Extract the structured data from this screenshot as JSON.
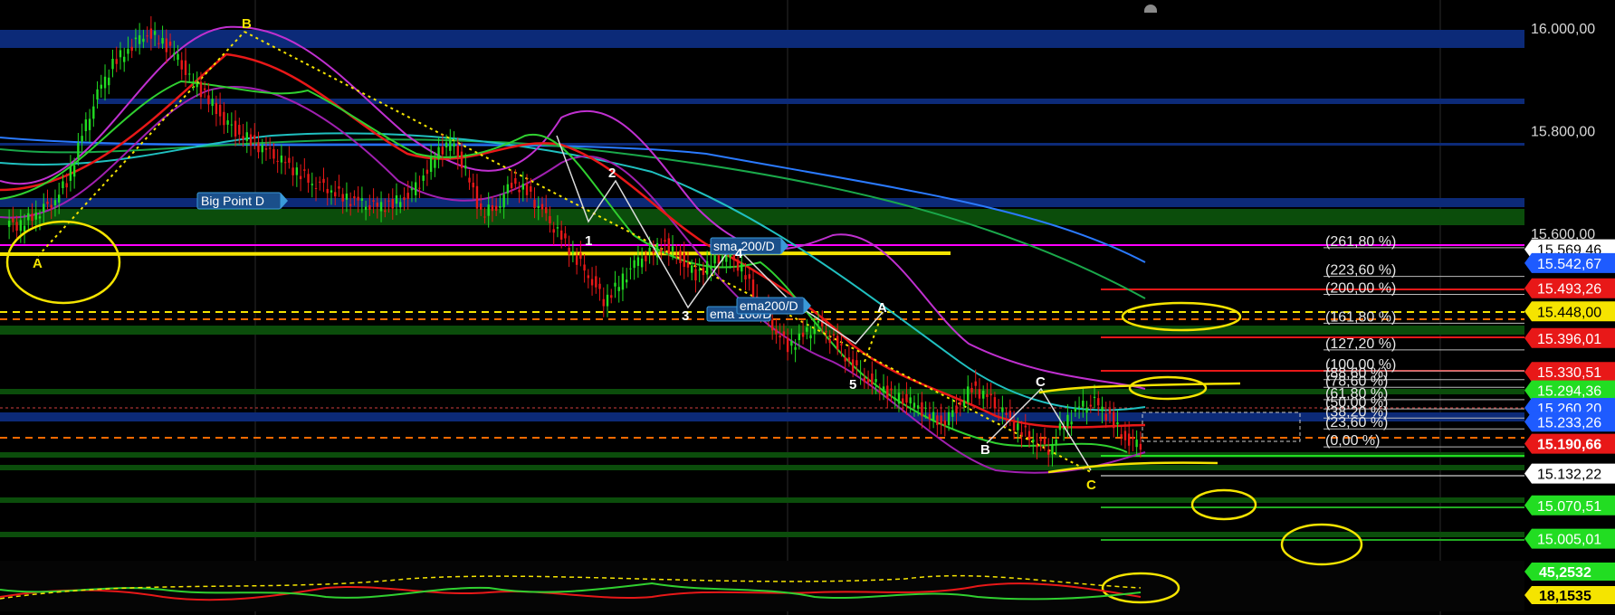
{
  "chart_data": {
    "type": "candlestick",
    "title": "",
    "ylim": [
      14950,
      16080
    ],
    "y_ticks": [
      "16.000,00",
      "15.800,00",
      "15.600,00"
    ],
    "y_tick_values": [
      16000,
      15800,
      15600
    ],
    "fib_levels": [
      {
        "label": "(261,80 %)",
        "value": 15572
      },
      {
        "label": "(223,60 %)",
        "value": 15516
      },
      {
        "label": "(200,00 %)",
        "value": 15481
      },
      {
        "label": "(161,80 %)",
        "value": 15425
      },
      {
        "label": "(127,20 %)",
        "value": 15373
      },
      {
        "label": "(100,00 %)",
        "value": 15332
      },
      {
        "label": "(88,60 %)",
        "value": 15315
      },
      {
        "label": "(78,60 %)",
        "value": 15300
      },
      {
        "label": "(61,80 %)",
        "value": 15276
      },
      {
        "label": "(50,00 %)",
        "value": 15258
      },
      {
        "label": "(38,20 %)",
        "value": 15240
      },
      {
        "label": "(23,60 %)",
        "value": 15219
      },
      {
        "label": "(0,00 %)",
        "value": 15184
      }
    ],
    "price_tags": [
      {
        "text": "15.569,46",
        "value": 15569,
        "color": "#ffffff",
        "text_color": "#000000"
      },
      {
        "text": "15.542,67",
        "value": 15542,
        "color": "#1e5bff",
        "text_color": "#ffffff"
      },
      {
        "text": "15.493,26",
        "value": 15493,
        "color": "#e81818",
        "text_color": "#ffffff"
      },
      {
        "text": "15.448,00",
        "value": 15448,
        "color": "#f5e400",
        "text_color": "#000000"
      },
      {
        "text": "15.396,01",
        "value": 15396,
        "color": "#e81818",
        "text_color": "#ffffff"
      },
      {
        "text": "15.330,51",
        "value": 15330,
        "color": "#e81818",
        "text_color": "#ffffff"
      },
      {
        "text": "15.294,36",
        "value": 15294,
        "color": "#22dd22",
        "text_color": "#ffffff"
      },
      {
        "text": "15.260,20",
        "value": 15260,
        "color": "#1e5bff",
        "text_color": "#ffffff"
      },
      {
        "text": "15.233,26",
        "value": 15233,
        "color": "#1e5bff",
        "text_color": "#ffffff"
      },
      {
        "text": "15.190,66",
        "value": 15190,
        "color": "#e81818",
        "text_color": "#ffffff",
        "bold": true
      },
      {
        "text": "15.132,22",
        "value": 15132,
        "color": "#ffffff",
        "text_color": "#000000"
      },
      {
        "text": "15.070,51",
        "value": 15070,
        "color": "#22dd22",
        "text_color": "#ffffff"
      },
      {
        "text": "15.005,01",
        "value": 15005,
        "color": "#22dd22",
        "text_color": "#ffffff"
      }
    ],
    "indicator_tags": [
      {
        "text": "45,2532",
        "color": "#22dd22",
        "text_color": "#ffffff"
      },
      {
        "text": "18,1535",
        "color": "#f5e400",
        "text_color": "#000000"
      }
    ],
    "annotations": {
      "big_point": "Big Point D",
      "sma200": "sma 200/D",
      "ema200": "ema200/D",
      "ema100": "ema 100/D"
    },
    "wave_labels": [
      {
        "text": "A",
        "color": "#f5e400"
      },
      {
        "text": "B",
        "color": "#f5e400"
      },
      {
        "text": "1",
        "color": "#ffffff"
      },
      {
        "text": "2",
        "color": "#ffffff"
      },
      {
        "text": "3",
        "color": "#ffffff"
      },
      {
        "text": "4",
        "color": "#ffffff"
      },
      {
        "text": "5",
        "color": "#ffffff"
      },
      {
        "text": "A",
        "color": "#ffffff"
      },
      {
        "text": "B",
        "color": "#ffffff"
      },
      {
        "text": "C",
        "color": "#ffffff"
      },
      {
        "text": "C",
        "color": "#f5e400"
      }
    ],
    "close_series": [
      15620,
      15615,
      15640,
      15660,
      15700,
      15790,
      15870,
      15930,
      15960,
      15990,
      15980,
      15950,
      15900,
      15870,
      15830,
      15800,
      15780,
      15760,
      15740,
      15720,
      15700,
      15690,
      15670,
      15660,
      15650,
      15655,
      15670,
      15700,
      15750,
      15780,
      15720,
      15640,
      15650,
      15700,
      15680,
      15640,
      15600,
      15560,
      15520,
      15470,
      15500,
      15540,
      15560,
      15580,
      15550,
      15520,
      15540,
      15560,
      15530,
      15470,
      15420,
      15380,
      15400,
      15420,
      15390,
      15350,
      15320,
      15300,
      15280,
      15270,
      15250,
      15230,
      15260,
      15300,
      15280,
      15250,
      15220,
      15200,
      15180,
      15230,
      15260,
      15270,
      15240,
      15200,
      15190
    ]
  }
}
